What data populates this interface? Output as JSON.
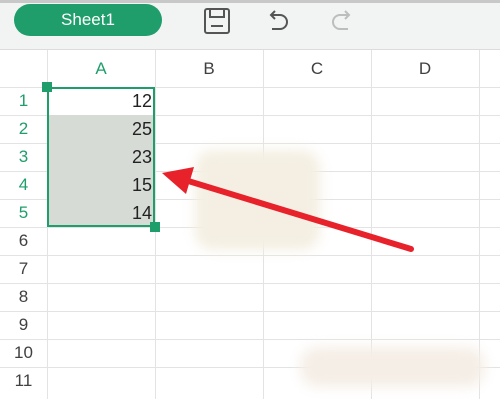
{
  "toolbar": {
    "sheet_tab_label": "Sheet1",
    "save_icon": "save-icon",
    "undo_icon": "undo-icon",
    "redo_icon": "redo-icon"
  },
  "columns": [
    "A",
    "B",
    "C",
    "D"
  ],
  "rows": [
    "1",
    "2",
    "3",
    "4",
    "5",
    "6",
    "7",
    "8",
    "9",
    "10",
    "11"
  ],
  "cells": {
    "A1": "12",
    "A2": "25",
    "A3": "23",
    "A4": "15",
    "A5": "14"
  },
  "selection": {
    "range": "A1:A5",
    "active_cell": "A1"
  },
  "colors": {
    "accent": "#1f9e6b",
    "selection_fill": "#d6dbd6",
    "arrow": "#e8222b"
  }
}
